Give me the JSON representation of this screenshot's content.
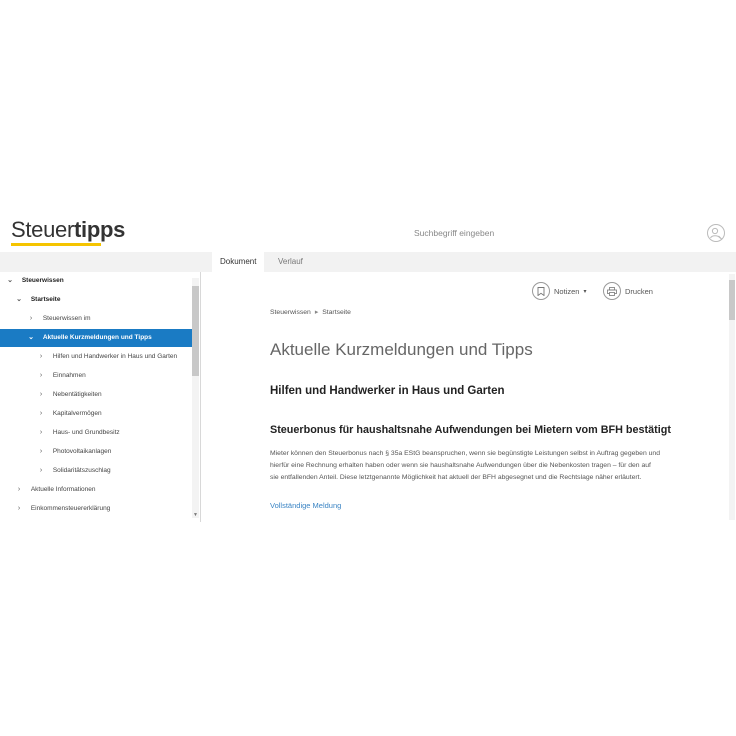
{
  "header": {
    "logo_part1": "Steuer",
    "logo_part2": "tipps",
    "search_placeholder": "Suchbegriff eingeben",
    "accent_color": "#f5c400"
  },
  "tabs": [
    {
      "label": "Dokument",
      "active": true
    },
    {
      "label": "Verlauf",
      "active": false
    }
  ],
  "sidebar": {
    "items": [
      {
        "label": "Steuerwissen",
        "icon": "chevron-down-icon",
        "chev": "⌄",
        "level": 0
      },
      {
        "label": "Startseite",
        "icon": "chevron-down-icon",
        "chev": "⌄",
        "level": 1
      },
      {
        "label": "Steuerwissen im",
        "icon": "chevron-right-icon",
        "chev": "›",
        "level": 2
      },
      {
        "label": "Aktuelle Kurzmeldungen und Tipps",
        "icon": "chevron-down-icon",
        "chev": "⌄",
        "level": 2,
        "selected": true
      },
      {
        "label": "Hilfen und Handwerker in Haus und Garten",
        "icon": "chevron-right-icon",
        "chev": "›",
        "level": 3
      },
      {
        "label": "Einnahmen",
        "icon": "chevron-right-icon",
        "chev": "›",
        "level": 3
      },
      {
        "label": "Nebentätigkeiten",
        "icon": "chevron-right-icon",
        "chev": "›",
        "level": 3
      },
      {
        "label": "Kapitalvermögen",
        "icon": "chevron-right-icon",
        "chev": "›",
        "level": 3
      },
      {
        "label": "Haus- und Grundbesitz",
        "icon": "chevron-right-icon",
        "chev": "›",
        "level": 3
      },
      {
        "label": "Photovoltaikanlagen",
        "icon": "chevron-right-icon",
        "chev": "›",
        "level": 3
      },
      {
        "label": "Solidaritätszuschlag",
        "icon": "chevron-right-icon",
        "chev": "›",
        "level": 3
      },
      {
        "label": "Aktuelle Informationen",
        "icon": "chevron-right-icon",
        "chev": "›",
        "level": 1
      },
      {
        "label": "Einkommensteuererklärung",
        "icon": "chevron-right-icon",
        "chev": "›",
        "level": 1
      }
    ],
    "selected_color": "#1a7bc4"
  },
  "toolbar": {
    "notes_label": "Notizen",
    "notes_caret": "▾",
    "print_label": "Drucken"
  },
  "content": {
    "breadcrumb": [
      "Steuerwissen",
      "Startseite"
    ],
    "title": "Aktuelle Kurzmeldungen und Tipps",
    "subheading": "Hilfen und Handwerker in Haus und Garten",
    "news_title": "Steuerbonus für haushaltsnahe Aufwendungen bei Mietern vom BFH bestätigt",
    "news_text": "Mieter können den Steuerbonus nach § 35a EStG beanspruchen, wenn sie begünstigte Leistungen selbst in Auftrag gegeben und hierfür eine Rechnung erhalten haben oder wenn sie haushaltsnahe Aufwendungen über die Nebenkosten tragen – für den auf sie entfallenden Anteil. Diese letztgenannte Möglichkeit hat aktuell der BFH abgesegnet und die Rechtslage näher erläutert.",
    "more_link": "Vollständige Meldung",
    "link_color": "#3a84c4"
  }
}
